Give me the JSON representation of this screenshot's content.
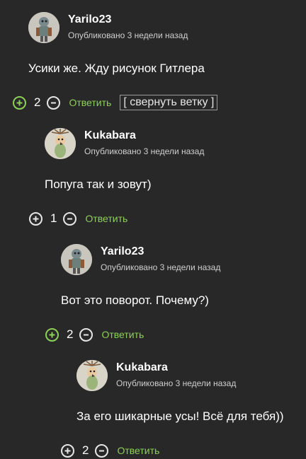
{
  "comments": [
    {
      "author": "Yarilo23",
      "meta": "Опубликовано 3 недели назад",
      "text": "Усики же. Жду рисунок Гитлера",
      "score": "2",
      "reply_label": "Ответить",
      "collapse_label": "[ свернуть ветку ]",
      "avatar_icon": "robot-avatar-icon"
    },
    {
      "author": "Kukabara",
      "meta": "Опубликовано 3 недели назад",
      "text": "Попуга так и зовут)",
      "score": "1",
      "reply_label": "Ответить",
      "avatar_icon": "bird-avatar-icon"
    },
    {
      "author": "Yarilo23",
      "meta": "Опубликовано 3 недели назад",
      "text": "Вот это поворот. Почему?)",
      "score": "2",
      "reply_label": "Ответить",
      "avatar_icon": "robot-avatar-icon"
    },
    {
      "author": "Kukabara",
      "meta": "Опубликовано 3 недели назад",
      "text": "За его шикарные усы! Всё для тебя))",
      "score": "2",
      "reply_label": "Ответить",
      "avatar_icon": "bird-avatar-icon"
    }
  ],
  "colors": {
    "background": "#282828",
    "accent_green": "#8cd05a",
    "text": "#ffffff",
    "meta_text": "#cfcfcf"
  }
}
